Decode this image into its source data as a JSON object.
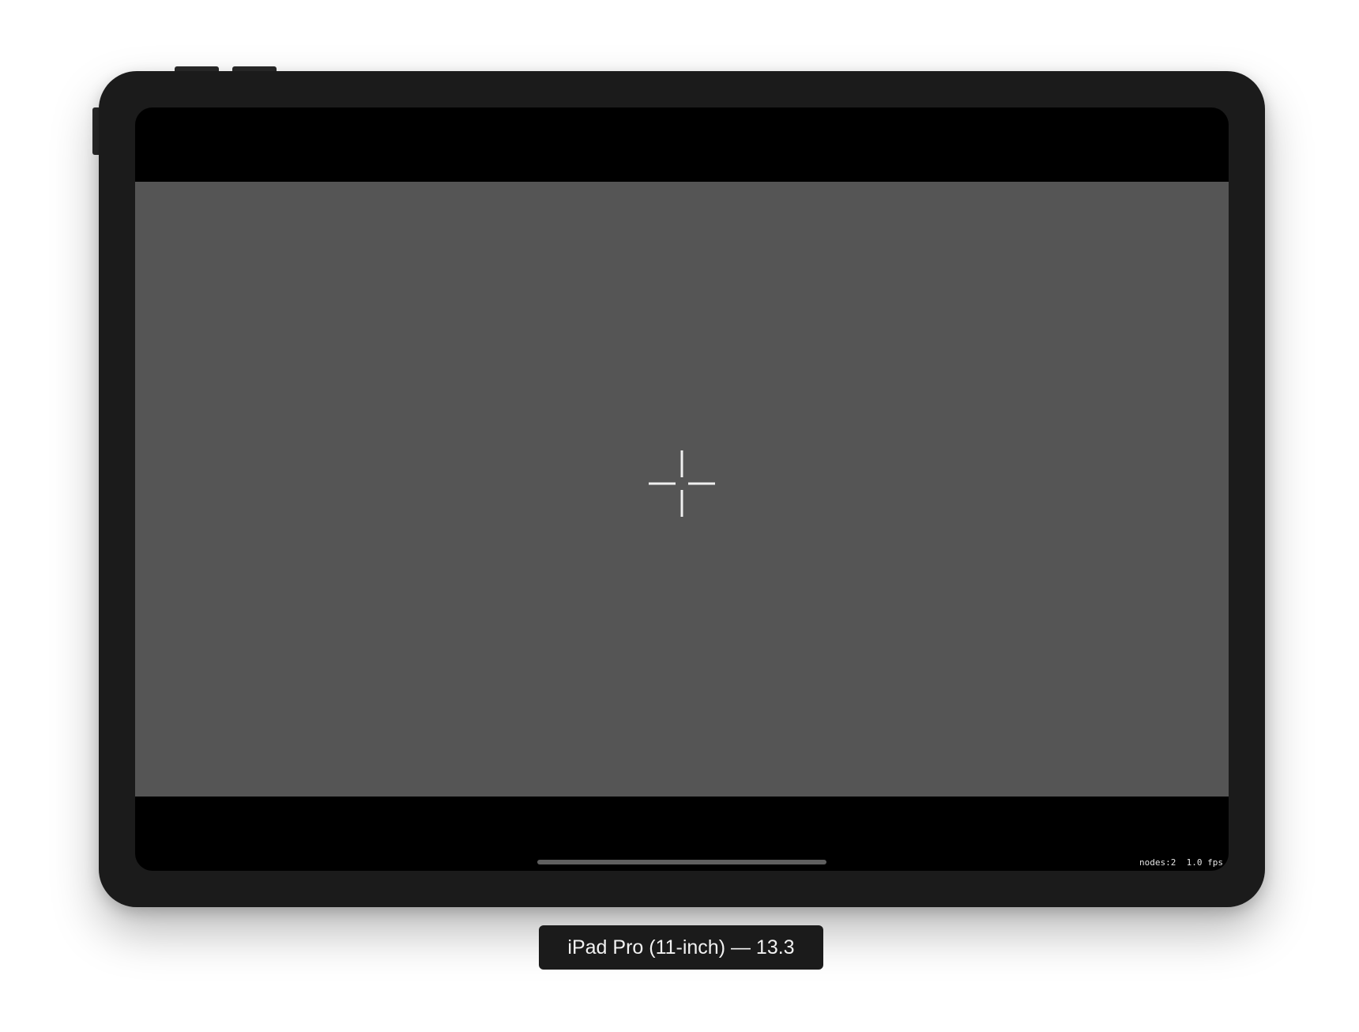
{
  "device": {
    "label": "iPad Pro (11-inch) — 13.3",
    "bezel_color": "#1b1b1b"
  },
  "screen": {
    "letterbox_color": "#000000",
    "viewport_color": "#555555",
    "crosshair_icon": "crosshair-icon",
    "stats": {
      "text": "nodes:2  1.0 fps"
    }
  }
}
